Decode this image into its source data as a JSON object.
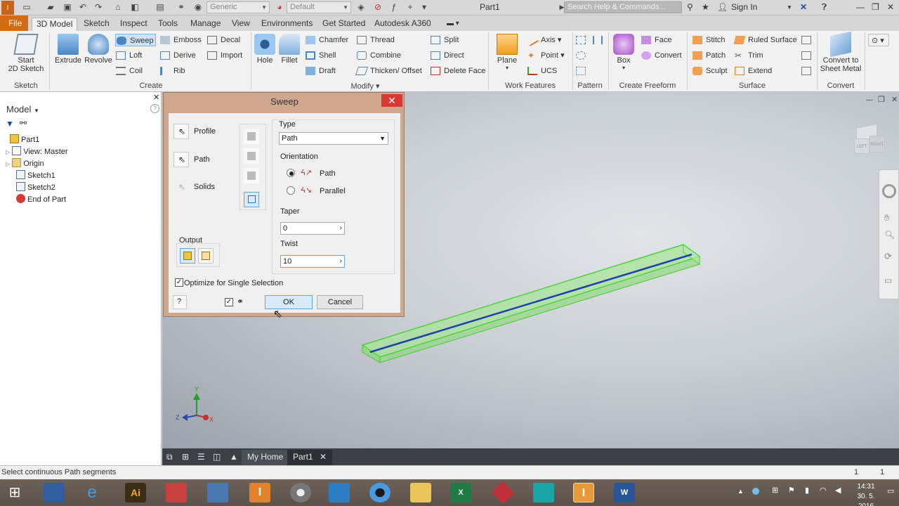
{
  "app": {
    "document_title": "Part1",
    "style_combo": "Generic",
    "appearance_combo": "Default",
    "search_placeholder": "Search Help & Commands...",
    "sign_in": "Sign In"
  },
  "tabs": [
    "File",
    "3D Model",
    "Sketch",
    "Inspect",
    "Tools",
    "Manage",
    "View",
    "Environments",
    "Get Started",
    "Autodesk A360"
  ],
  "ribbon": {
    "sketch": {
      "title": "Sketch",
      "start_sketch": "Start",
      "start_sketch2": "2D Sketch"
    },
    "create": {
      "title": "Create",
      "extrude": "Extrude",
      "revolve": "Revolve",
      "sweep": "Sweep",
      "loft": "Loft",
      "coil": "Coil",
      "emboss": "Emboss",
      "derive": "Derive",
      "rib": "Rib",
      "decal": "Decal",
      "import": "Import"
    },
    "modify": {
      "title": "Modify",
      "hole": "Hole",
      "fillet": "Fillet",
      "chamfer": "Chamfer",
      "shell": "Shell",
      "draft": "Draft",
      "thread": "Thread",
      "combine": "Combine",
      "thicken": "Thicken/ Offset",
      "split": "Split",
      "direct": "Direct",
      "delete_face": "Delete Face"
    },
    "work_features": {
      "title": "Work Features",
      "plane": "Plane",
      "axis": "Axis",
      "point": "Point",
      "ucs": "UCS"
    },
    "pattern": {
      "title": "Pattern"
    },
    "freeform": {
      "title": "Create Freeform",
      "box": "Box",
      "face": "Face",
      "convert": "Convert"
    },
    "surface": {
      "title": "Surface",
      "stitch": "Stitch",
      "patch": "Patch",
      "sculpt": "Sculpt",
      "ruled": "Ruled Surface",
      "trim": "Trim",
      "extend": "Extend"
    },
    "convert": {
      "title": "Convert",
      "label1": "Convert to",
      "label2": "Sheet Metal"
    }
  },
  "browser": {
    "title": "Model",
    "items": [
      "Part1",
      "View: Master",
      "Origin",
      "Sketch1",
      "Sketch2",
      "End of Part"
    ]
  },
  "dialog": {
    "title": "Sweep",
    "profile": "Profile",
    "path": "Path",
    "solids": "Solids",
    "output": "Output",
    "type_label": "Type",
    "type_value": "Path",
    "orientation_label": "Orientation",
    "orient_path": "Path",
    "orient_parallel": "Parallel",
    "taper_label": "Taper",
    "taper_value": "0",
    "twist_label": "Twist",
    "twist_value": "10",
    "optimize": "Optimize for Single Selection",
    "ok": "OK",
    "cancel": "Cancel"
  },
  "viewport": {
    "viewcube_left": "LEFT",
    "viewcube_right": "RIGHT",
    "axis_x": "X",
    "axis_y": "Y",
    "axis_z": "Z"
  },
  "doc_tabs": {
    "home": "My Home",
    "part": "Part1"
  },
  "status": {
    "message": "Select continuous Path segments",
    "count1": "1",
    "count2": "1"
  },
  "taskbar": {
    "time": "14:31",
    "date": "30. 5. 2016"
  },
  "colors": {
    "file_tab": "#d36b14",
    "sweep_body": "#8fe07d",
    "path_line": "#1f3fa8"
  }
}
